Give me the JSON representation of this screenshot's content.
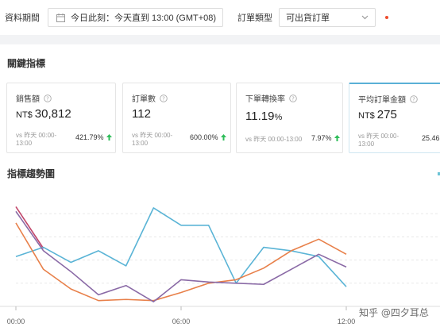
{
  "filters": {
    "period_label": "資料期間",
    "date_range": "今日此刻：今天直到 13:00 (GMT+08)",
    "order_type_label": "訂單類型",
    "order_type_value": "可出貨訂單"
  },
  "key_metrics": {
    "title": "關鍵指標",
    "cards": [
      {
        "label": "銷售額",
        "currency": "NT$",
        "value": "30,812",
        "unit": "",
        "compare": "vs 昨天 00:00-13:00",
        "change": "421.79%",
        "trend": "up"
      },
      {
        "label": "訂單數",
        "currency": "",
        "value": "112",
        "unit": "",
        "compare": "vs 昨天 00:00-13:00",
        "change": "600.00%",
        "trend": "up"
      },
      {
        "label": "下單轉換率",
        "currency": "",
        "value": "11.19",
        "unit": "%",
        "compare": "vs 昨天 00:00-13:00",
        "change": "7.97%",
        "trend": "up"
      },
      {
        "label": "平均訂單金額",
        "currency": "NT$",
        "value": "275",
        "unit": "",
        "compare": "vs 昨天 00:00-13:00",
        "change": "25.46",
        "trend": "up"
      }
    ]
  },
  "trend": {
    "title": "指標趨勢圖"
  },
  "watermark": "知乎 @四夕耳总",
  "colors": {
    "accent": "#5ab0d6",
    "up": "#2ebd59",
    "danger": "#ee4d2d",
    "series": [
      "#5ab4d6",
      "#e8804a",
      "#8a6aa6",
      "#c2476b"
    ]
  },
  "chart_data": {
    "type": "line",
    "x_ticks": [
      "00:00",
      "06:00",
      "12:00"
    ],
    "x": [
      0,
      1,
      2,
      3,
      4,
      5,
      6,
      7,
      8,
      9,
      10,
      11,
      12
    ],
    "ylim": [
      0,
      100
    ],
    "grid": true,
    "series": [
      {
        "values": [
          43,
          51,
          38,
          48,
          35,
          85,
          70,
          70,
          20,
          51,
          48,
          43,
          17
        ]
      },
      {
        "values": [
          72,
          32,
          15,
          5,
          6,
          5,
          12,
          20,
          23,
          33,
          48,
          58,
          45
        ]
      },
      {
        "values": [
          82,
          48,
          30,
          10,
          18,
          4,
          23,
          21,
          20,
          19,
          32,
          45,
          34
        ]
      },
      {
        "values": [
          86,
          50
        ]
      }
    ]
  }
}
